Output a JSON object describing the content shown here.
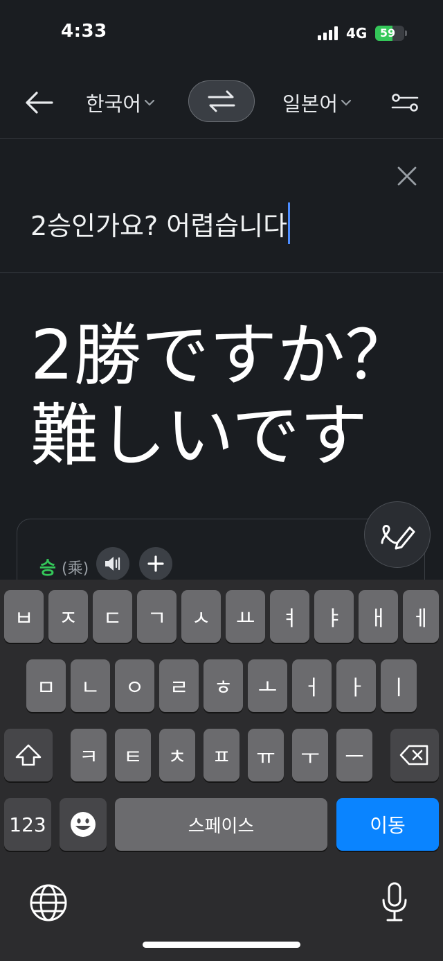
{
  "status_bar": {
    "time": "4:33",
    "network": "4G",
    "battery": "59",
    "battery_fill": 0.59,
    "colors": {
      "battery": "#34c759"
    }
  },
  "header": {
    "back_icon": "arrow-left-icon",
    "source_lang": "한국어",
    "target_lang": "일본어",
    "swap_icon": "swap-arrows-icon",
    "settings_icon": "sliders-icon"
  },
  "input": {
    "text": "2승인가요? 어렵습니다",
    "clear_icon": "close-icon",
    "caret_color": "#4c8dff"
  },
  "result": {
    "line1": "2勝ですか？",
    "line2": "難しいです"
  },
  "dictionary": {
    "word": "승",
    "hanja": "(乘)",
    "speaker_icon": "speaker-icon",
    "add_icon": "plus-icon",
    "word_color": "#34c759"
  },
  "handwrite_icon": "handwriting-pen-icon",
  "keyboard": {
    "row1": [
      "ㅂ",
      "ㅈ",
      "ㄷ",
      "ㄱ",
      "ㅅ",
      "ㅛ",
      "ㅕ",
      "ㅑ",
      "ㅐ",
      "ㅔ"
    ],
    "row2": [
      "ㅁ",
      "ㄴ",
      "ㅇ",
      "ㄹ",
      "ㅎ",
      "ㅗ",
      "ㅓ",
      "ㅏ",
      "ㅣ"
    ],
    "row3": [
      "ㅋ",
      "ㅌ",
      "ㅊ",
      "ㅍ",
      "ㅠ",
      "ㅜ",
      "ㅡ"
    ],
    "shift_icon": "shift-icon",
    "delete_icon": "backspace-icon",
    "numbers_label": "123",
    "emoji_icon": "emoji-icon",
    "space_label": "스페이스",
    "go_label": "이동",
    "globe_icon": "globe-icon",
    "mic_icon": "microphone-icon",
    "colors": {
      "go": "#0a84ff"
    }
  }
}
